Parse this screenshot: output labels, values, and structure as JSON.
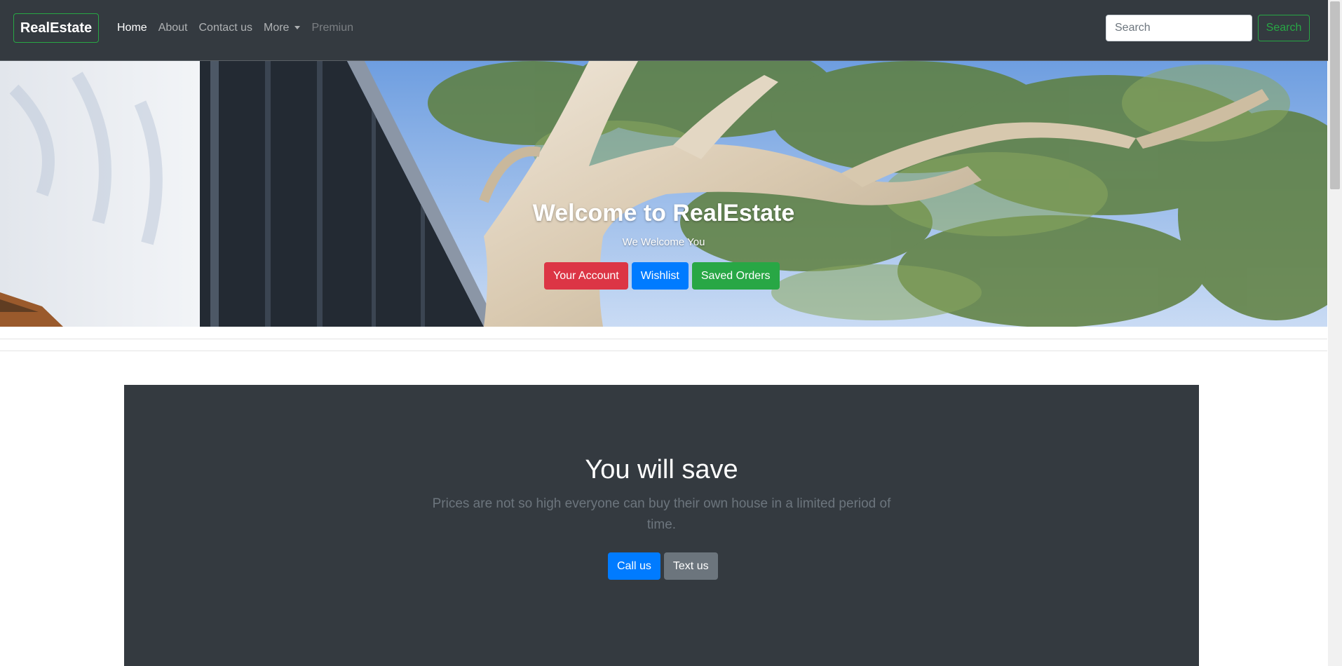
{
  "navbar": {
    "brand": "RealEstate",
    "links": [
      {
        "label": "Home"
      },
      {
        "label": "About"
      },
      {
        "label": "Contact us"
      },
      {
        "label": "More"
      },
      {
        "label": "Premiun"
      }
    ],
    "search": {
      "placeholder": "Search",
      "button_label": "Search"
    }
  },
  "hero": {
    "title": "Welcome to RealEstate",
    "subtitle": "We Welcome You",
    "buttons": {
      "account": "Your Account",
      "wishlist": "Wishlist",
      "saved_orders": "Saved Orders"
    }
  },
  "jumbotron": {
    "title": "You will save",
    "text": "Prices are not so high everyone can buy their own house in a limited period of time.",
    "buttons": {
      "call": "Call us",
      "text": "Text us"
    }
  },
  "colors": {
    "navbar_bg": "#343a40",
    "accent_success": "#28a745",
    "accent_danger": "#dc3545",
    "accent_primary": "#007bff",
    "secondary": "#6c757d"
  }
}
